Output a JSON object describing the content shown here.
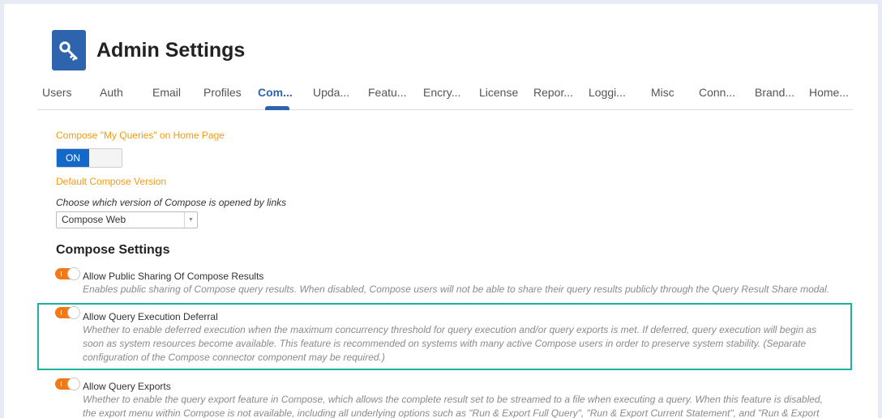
{
  "page": {
    "title": "Admin Settings",
    "icon": "key-icon"
  },
  "tabs": [
    {
      "label": "Users"
    },
    {
      "label": "Auth"
    },
    {
      "label": "Email"
    },
    {
      "label": "Profiles"
    },
    {
      "label": "Com...",
      "active": true
    },
    {
      "label": "Upda..."
    },
    {
      "label": "Featu..."
    },
    {
      "label": "Encry..."
    },
    {
      "label": "License"
    },
    {
      "label": "Repor..."
    },
    {
      "label": "Loggi..."
    },
    {
      "label": "Misc"
    },
    {
      "label": "Conn..."
    },
    {
      "label": "Brand..."
    },
    {
      "label": "Home..."
    }
  ],
  "my_queries": {
    "label": "Compose \"My Queries\" on Home Page",
    "toggle_on": "ON"
  },
  "default_version": {
    "label": "Default Compose Version",
    "helper": "Choose which version of Compose is opened by links",
    "selected": "Compose Web"
  },
  "section_title": "Compose Settings",
  "settings": [
    {
      "title": "Allow Public Sharing Of Compose Results",
      "desc": "Enables public sharing of Compose query results. When disabled, Compose users will not be able to share their query results publicly through the Query Result Share modal.",
      "enabled": true
    },
    {
      "title": "Allow Query Execution Deferral",
      "desc": "Whether to enable deferred execution when the maximum concurrency threshold for query execution and/or query exports is met. If deferred, query execution will begin as soon as system resources become available. This feature is recommended on systems with many active Compose users in order to preserve system stability. (Separate configuration of the Compose connector component may be required.)",
      "enabled": true
    },
    {
      "title": "Allow Query Exports",
      "desc": "Whether to enable the query export feature in Compose, which allows the complete result set to be streamed to a file when executing a query. When this feature is disabled, the export menu within Compose is not available, including all underlying options such as \"Run & Export Full Query\", \"Run & Export Current Statement\", and \"Run & Export as",
      "enabled": true
    }
  ],
  "colors": {
    "accent": "#2e64ad",
    "orange": "#f39a16",
    "switch": "#f07a1a",
    "highlight": "#1db1a0"
  }
}
